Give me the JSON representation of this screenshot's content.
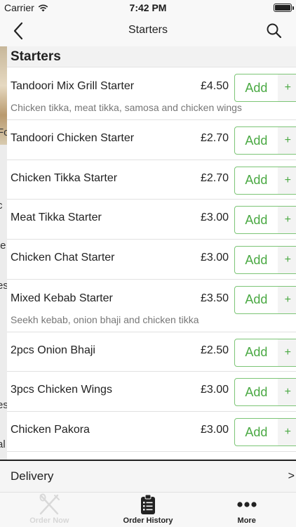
{
  "status_bar": {
    "carrier": "Carrier",
    "time": "7:42 PM",
    "battery_level": 1.0
  },
  "nav": {
    "title": "Starters",
    "back_icon": "chevron-left-icon",
    "search_icon": "search-icon"
  },
  "left_peek": {
    "chars": [
      "Fo",
      "c",
      "te",
      "es",
      "es",
      "al"
    ]
  },
  "section": {
    "title": "Starters"
  },
  "add_label": "Add",
  "plus_label": "+",
  "items": [
    {
      "name": "Tandoori Mix Grill Starter",
      "price": "£4.50",
      "description": "Chicken tikka, meat tikka, samosa and chicken wings"
    },
    {
      "name": "Tandoori Chicken Starter",
      "price": "£2.70"
    },
    {
      "name": "Chicken Tikka Starter",
      "price": "£2.70"
    },
    {
      "name": "Meat Tikka Starter",
      "price": "£3.00"
    },
    {
      "name": "Chicken Chat Starter",
      "price": "£3.00"
    },
    {
      "name": "Mixed Kebab Starter",
      "price": "£3.50",
      "description": "Seekh kebab, onion bhaji and chicken tikka"
    },
    {
      "name": "2pcs Onion Bhaji",
      "price": "£2.50"
    },
    {
      "name": "3pcs Chicken Wings",
      "price": "£3.00"
    },
    {
      "name": "Chicken Pakora",
      "price": "£3.00"
    }
  ],
  "delivery": {
    "label": "Delivery",
    "arrow": ">"
  },
  "tabs": [
    {
      "label": "Order Now",
      "icon": "fork-knife-icon",
      "active": false
    },
    {
      "label": "Order History",
      "icon": "clipboard-icon",
      "active": true
    },
    {
      "label": "More",
      "icon": "more-dots-icon",
      "active": true
    }
  ],
  "colors": {
    "accent_green": "#4aa943",
    "button_border": "#7cc576",
    "nav_background": "#f8f8f8"
  }
}
